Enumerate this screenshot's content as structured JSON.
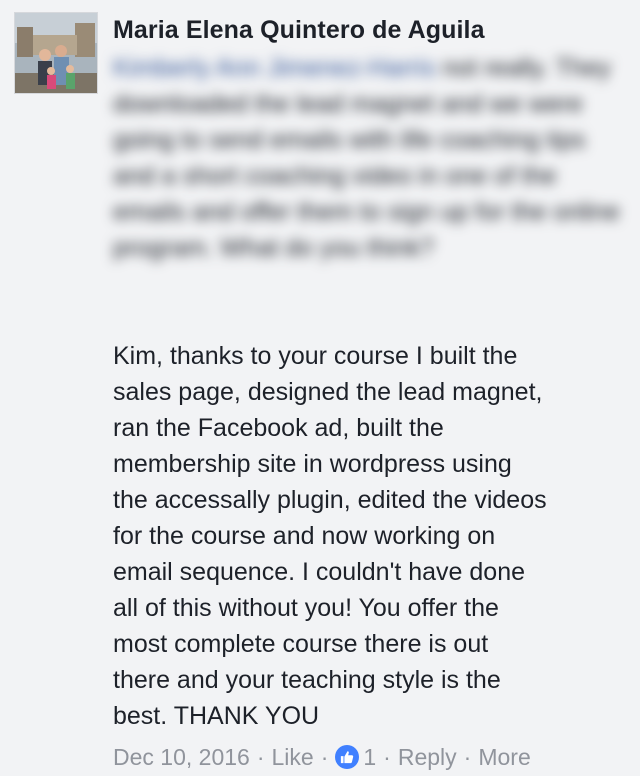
{
  "comment": {
    "author": "Maria Elena Quintero de Aguila",
    "blurred_mention": "Kimberly Ann Jimenez-Harris",
    "blurred_text": " not really. They downloaded the lead magnet and we were going to send emails with life coaching tips and a short coaching video in one of the emails and offer them to sign up for the online program. What do you think?",
    "body": "Kim, thanks to your course I built the\nsales page, designed the lead magnet,\nran the Facebook ad, built the\nmembership site in wordpress using\nthe accessally plugin, edited the videos\nfor the course and now working on\nemail sequence. I couldn't have done\nall of this without you! You offer the\nmost complete course there is out\nthere and your teaching style is the\nbest. THANK YOU",
    "date": "Dec 10, 2016",
    "like_label": "Like",
    "like_count": "1",
    "reply_label": "Reply",
    "more_label": "More",
    "separator": "·"
  },
  "colors": {
    "background": "#f2f3f5",
    "text": "#1d2129",
    "meta": "#90949c",
    "like_badge": "#4080ff",
    "mention": "#365899"
  },
  "icons": {
    "avatar": "profile-photo",
    "like": "thumbs-up-icon"
  }
}
